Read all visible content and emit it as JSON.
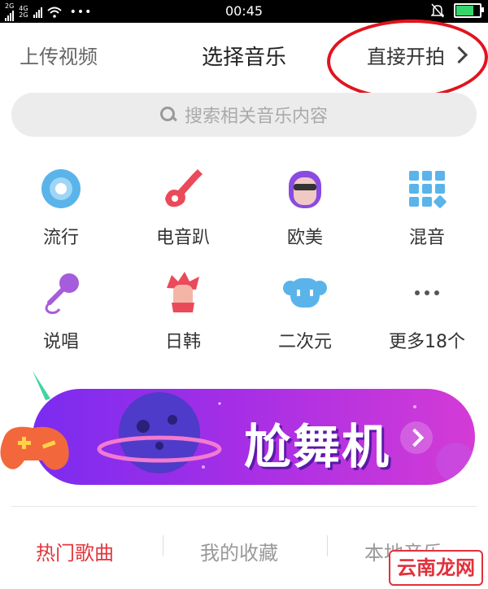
{
  "status_bar": {
    "sim1": "2G",
    "sim2": "4G",
    "sim2b": "2G",
    "more": "•••",
    "time": "00:45"
  },
  "header": {
    "left": "上传视频",
    "title": "选择音乐",
    "right": "直接开拍"
  },
  "search": {
    "placeholder": "搜索相关音乐内容"
  },
  "categories": [
    {
      "label": "流行",
      "icon": "disc-icon"
    },
    {
      "label": "电音趴",
      "icon": "electric-guitar-icon"
    },
    {
      "label": "欧美",
      "icon": "woman-avatar-icon"
    },
    {
      "label": "混音",
      "icon": "grid-icon"
    },
    {
      "label": "说唱",
      "icon": "microphone-icon"
    },
    {
      "label": "日韩",
      "icon": "anime-boy-icon"
    },
    {
      "label": "二次元",
      "icon": "cloud-character-icon"
    },
    {
      "label": "更多18个",
      "icon": "more-dots-icon"
    }
  ],
  "banner": {
    "text": "尬舞机"
  },
  "tabs": [
    "热门歌曲",
    "我的收藏",
    "本地音乐"
  ],
  "watermark": "云南龙网",
  "colors": {
    "accent_red": "#e3353b",
    "banner_start": "#7a2cf0",
    "banner_end": "#d43bd6",
    "annotation_ring": "#e0141e"
  }
}
